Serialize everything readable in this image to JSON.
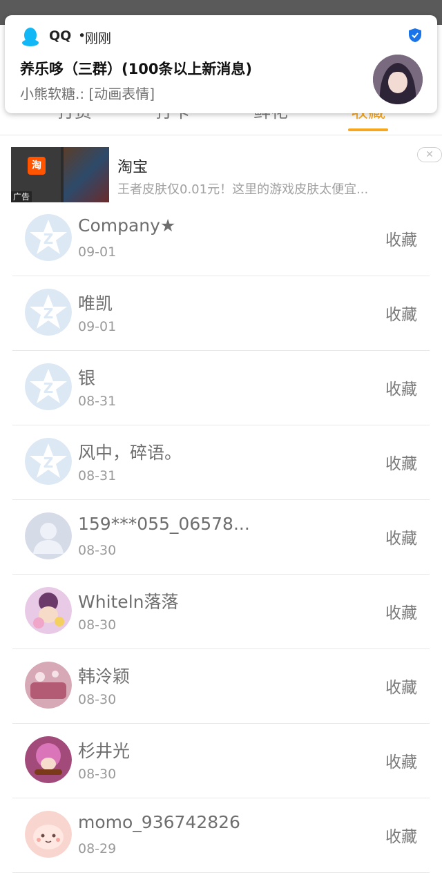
{
  "notification": {
    "app": "QQ",
    "separator": "•",
    "time": "刚刚",
    "title": "养乐哆（三群）(100条以上新消息)",
    "text": "小熊软糖.: [动画表情]",
    "icon": "qq-penguin-icon",
    "verified_icon": "shield-check-icon"
  },
  "tabs": [
    {
      "label": "打赏"
    },
    {
      "label": "打卡"
    },
    {
      "label": "鲜花"
    },
    {
      "label": "收藏",
      "active": true
    }
  ],
  "ad": {
    "title": "淘宝",
    "description": "王者皮肤仅0.01元！这里的游戏皮肤太便宜...",
    "tag": "广告",
    "logo_text": "淘",
    "close_icon": "close-icon"
  },
  "items": [
    {
      "name": "Company★",
      "date": "09-01",
      "action": "收藏",
      "avatar": "qzone-default"
    },
    {
      "name": "唯凯",
      "date": "09-01",
      "action": "收藏",
      "avatar": "qzone-default"
    },
    {
      "name": "银",
      "date": "08-31",
      "action": "收藏",
      "avatar": "qzone-default"
    },
    {
      "name": "风中，碎语。",
      "date": "08-31",
      "action": "收藏",
      "avatar": "qzone-default"
    },
    {
      "name": "159***055_06578...",
      "date": "08-30",
      "action": "收藏",
      "avatar": "silhouette"
    },
    {
      "name": "Whiteln落落",
      "date": "08-30",
      "action": "收藏",
      "avatar": "photo"
    },
    {
      "name": "韩泠颖",
      "date": "08-30",
      "action": "收藏",
      "avatar": "photo"
    },
    {
      "name": "杉井光",
      "date": "08-30",
      "action": "收藏",
      "avatar": "photo"
    },
    {
      "name": "momo_936742826",
      "date": "08-29",
      "action": "收藏",
      "avatar": "photo"
    }
  ],
  "colors": {
    "accent": "#f5a623",
    "statusbar": "#5a5a5a",
    "qq_blue": "#12b7f5"
  }
}
